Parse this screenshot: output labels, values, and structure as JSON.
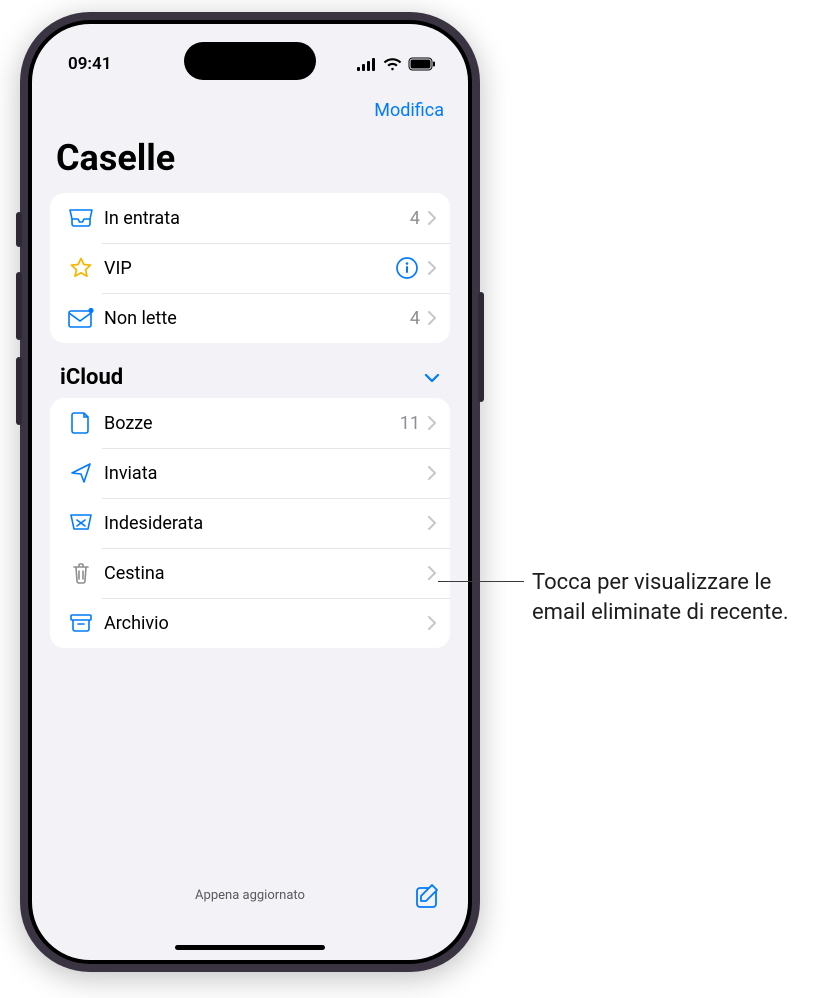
{
  "status": {
    "time": "09:41"
  },
  "nav": {
    "edit": "Modifica"
  },
  "title": "Caselle",
  "mailboxes": {
    "primary": [
      {
        "icon": "inbox-icon",
        "label": "In entrata",
        "badge": "4",
        "info": false
      },
      {
        "icon": "star-icon",
        "label": "VIP",
        "badge": null,
        "info": true
      },
      {
        "icon": "unread-icon",
        "label": "Non lette",
        "badge": "4",
        "info": false
      }
    ],
    "section": {
      "title": "iCloud"
    },
    "icloud": [
      {
        "icon": "draft-icon",
        "label": "Bozze",
        "badge": "11"
      },
      {
        "icon": "sent-icon",
        "label": "Inviata",
        "badge": null
      },
      {
        "icon": "junk-icon",
        "label": "Indesiderata",
        "badge": null
      },
      {
        "icon": "trash-icon",
        "label": "Cestina",
        "badge": null
      },
      {
        "icon": "archive-icon",
        "label": "Archivio",
        "badge": null
      }
    ]
  },
  "toolbar": {
    "status": "Appena aggiornato"
  },
  "callout": {
    "text": "Tocca per visualizzare le email eliminate di recente."
  }
}
